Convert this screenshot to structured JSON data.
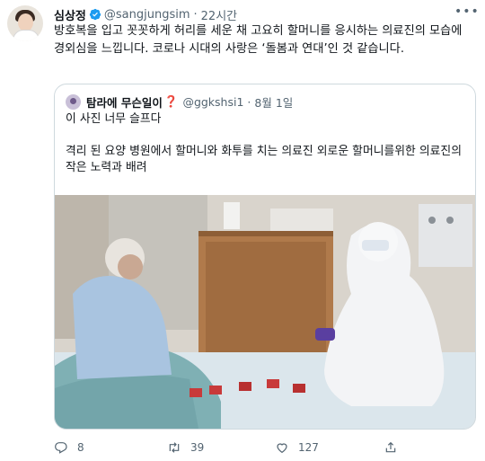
{
  "tweet": {
    "author_name": "심상정",
    "handle": "@sangjungsim",
    "separator": "·",
    "time": "22시간",
    "more_label": "•••",
    "text": "방호복을 입고 꼿꼿하게 허리를 세운 채 고요히 할머니를 응시하는 의료진의 모습에 경외심을 느낍니다. 코로나 시대의 사랑은 ‘돌봄과 연대’인 것 같습니다."
  },
  "quote": {
    "author_name": "탐라에 무슨일이",
    "emoji": "❓",
    "handle": "@ggkshsi1",
    "separator": "·",
    "date": "8월 1일",
    "line1": "이 사진 너무 슬프다",
    "line2": "격리 된 요양 병원에서 할머니와 화투를 치는 의료진 외로운 할머니를위한 의료진의 작은 노력과 배려"
  },
  "actions": {
    "reply_count": "8",
    "retweet_count": "39",
    "like_count": "127"
  },
  "colors": {
    "text": "#0f1419",
    "secondary": "#536471",
    "verified": "#1d9bf0",
    "border": "#cfd9de"
  },
  "icons": [
    "verified-badge-icon",
    "more-icon",
    "reply-icon",
    "retweet-icon",
    "like-icon",
    "share-icon"
  ]
}
